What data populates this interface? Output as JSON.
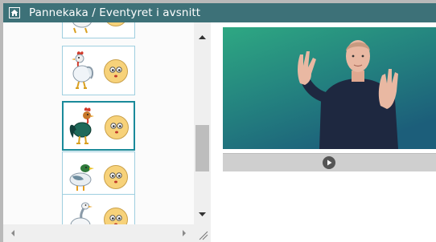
{
  "window": {
    "title": "Pannekaka / Eventyret i avsnitt"
  },
  "icons": {
    "home": "home-icon",
    "scroll_up": "arrow-up-icon",
    "scroll_down": "arrow-down-icon",
    "scroll_left": "arrow-left-icon",
    "scroll_right": "arrow-right-icon",
    "play": "play-icon",
    "resize": "resize-grip-icon"
  },
  "list": {
    "items": [
      {
        "animal": "hen",
        "pancake": "pancake-face",
        "selected": false
      },
      {
        "animal": "rooster",
        "pancake": "pancake-face",
        "selected": false
      },
      {
        "animal": "rooster",
        "pancake": "pancake-face",
        "selected": true
      },
      {
        "animal": "duck",
        "pancake": "pancake-face",
        "selected": false
      },
      {
        "animal": "goose",
        "pancake": "pancake-face",
        "selected": false
      }
    ]
  },
  "colors": {
    "titlebar": "#3d7178",
    "selected_border": "#1a8a9a",
    "card_border": "#9fcfe0",
    "video_bg_top": "#2ea882",
    "video_bg_bottom": "#1c5e7a"
  }
}
